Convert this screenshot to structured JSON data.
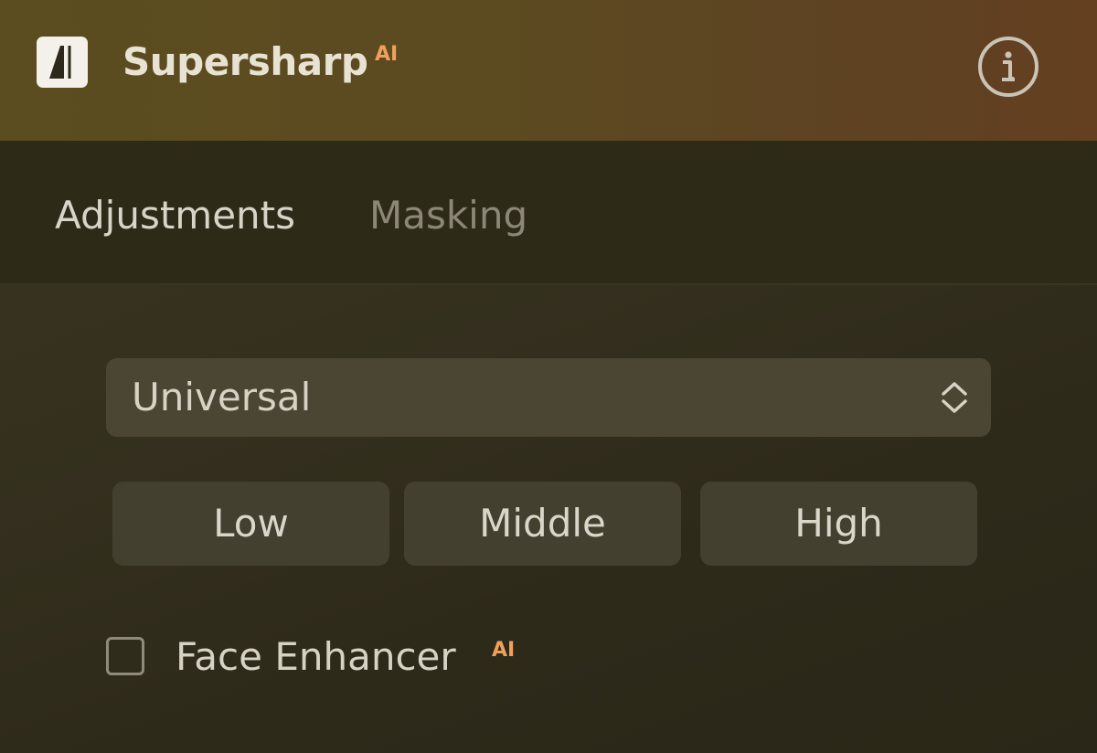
{
  "header": {
    "app_name": "Supersharp",
    "ai_badge": "AI",
    "logo_icon": "app-logo-icon",
    "info_icon": "info-icon"
  },
  "tabs": [
    {
      "label": "Adjustments",
      "active": true
    },
    {
      "label": "Masking",
      "active": false
    }
  ],
  "model_select": {
    "value": "Universal",
    "icon": "chevron-up-down-icon"
  },
  "strength_options": [
    {
      "label": "Low"
    },
    {
      "label": "Middle"
    },
    {
      "label": "High"
    }
  ],
  "face_enhancer": {
    "label": "Face Enhancer",
    "ai_badge": "AI",
    "checked": false
  },
  "colors": {
    "accent_ai": "#f0a05a",
    "header_start": "#5b4d1f",
    "header_end": "#643f20",
    "panel_bg": "#2e2a18",
    "control_bg": "#4b4533",
    "button_bg": "#444030",
    "text_primary": "#d8d4c8",
    "text_muted": "#8c8778"
  }
}
